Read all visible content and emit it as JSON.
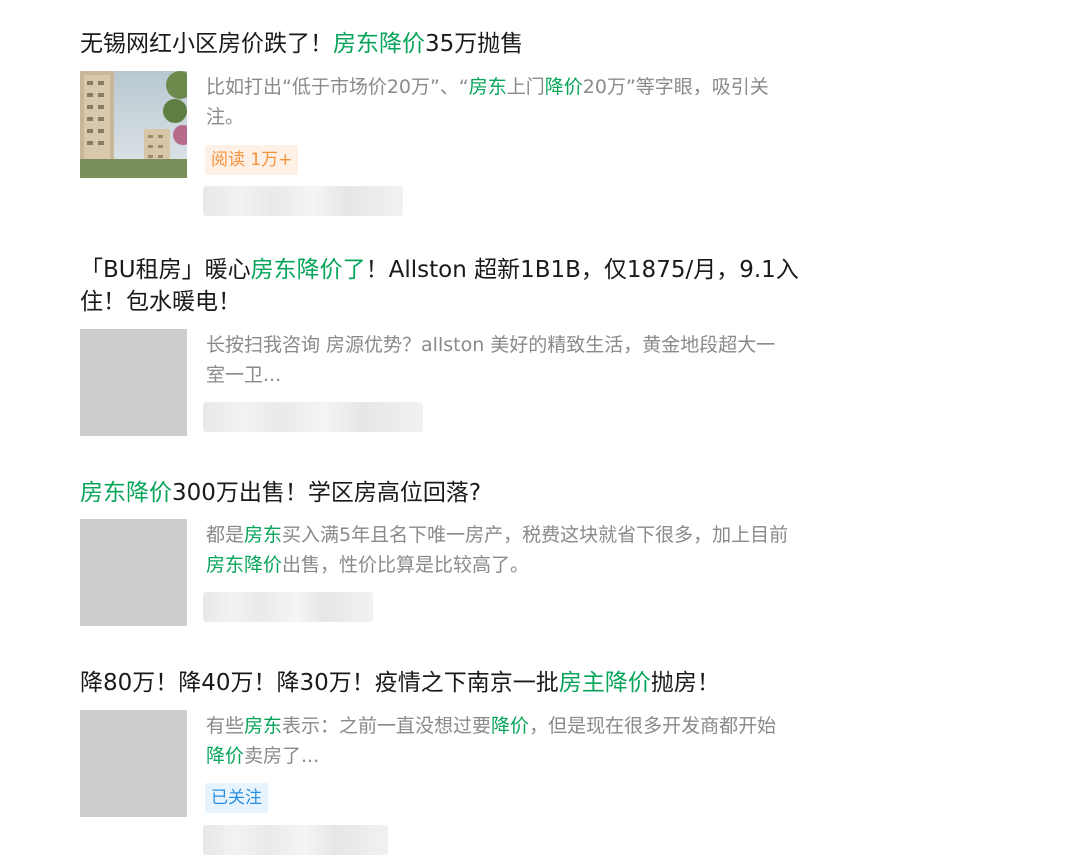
{
  "results": [
    {
      "title_parts": [
        {
          "text": "无锡网红小区房价跌了！",
          "hl": false
        },
        {
          "text": "房东降价",
          "hl": true
        },
        {
          "text": "35万抛售",
          "hl": false
        }
      ],
      "snippet_parts": [
        {
          "text": "比如打出“低于市场价20万”、“",
          "hl": false
        },
        {
          "text": "房东",
          "hl": true
        },
        {
          "text": "上门",
          "hl": false
        },
        {
          "text": "降价",
          "hl": true
        },
        {
          "text": "20万”等字眼，吸引关注。",
          "hl": false
        }
      ],
      "tag": "阅读 1万+"
    },
    {
      "title_parts": [
        {
          "text": "「BU租房」暖心",
          "hl": false
        },
        {
          "text": "房东降价了",
          "hl": true
        },
        {
          "text": "！Allston 超新1B1B，仅1875/月，9.1入住！包水暖电！",
          "hl": false
        }
      ],
      "snippet_parts": [
        {
          "text": "长按扫我咨询 房源优势？allston 美好的精致生活，黄金地段超大一室一卫...",
          "hl": false
        }
      ]
    },
    {
      "title_parts": [
        {
          "text": "房东降价",
          "hl": true
        },
        {
          "text": "300万出售！学区房高位回落?",
          "hl": false
        }
      ],
      "snippet_parts": [
        {
          "text": "都是",
          "hl": false
        },
        {
          "text": "房东",
          "hl": true
        },
        {
          "text": "买入满5年且名下唯一房产，税费这块就省下很多，加上目前",
          "hl": false
        },
        {
          "text": "房东降价",
          "hl": true
        },
        {
          "text": "出售，性价比算是比较高了。",
          "hl": false
        }
      ]
    },
    {
      "title_parts": [
        {
          "text": "降80万！降40万！降30万！疫情之下南京一批",
          "hl": false
        },
        {
          "text": "房主降价",
          "hl": true
        },
        {
          "text": "抛房！",
          "hl": false
        }
      ],
      "snippet_parts": [
        {
          "text": "有些",
          "hl": false
        },
        {
          "text": "房东",
          "hl": true
        },
        {
          "text": "表示：之前一直没想过要",
          "hl": false
        },
        {
          "text": "降价",
          "hl": true
        },
        {
          "text": "，但是现在很多开发商都开始",
          "hl": false
        },
        {
          "text": "降价",
          "hl": true
        },
        {
          "text": "卖房了...",
          "hl": false
        }
      ],
      "tag": "已关注"
    }
  ]
}
